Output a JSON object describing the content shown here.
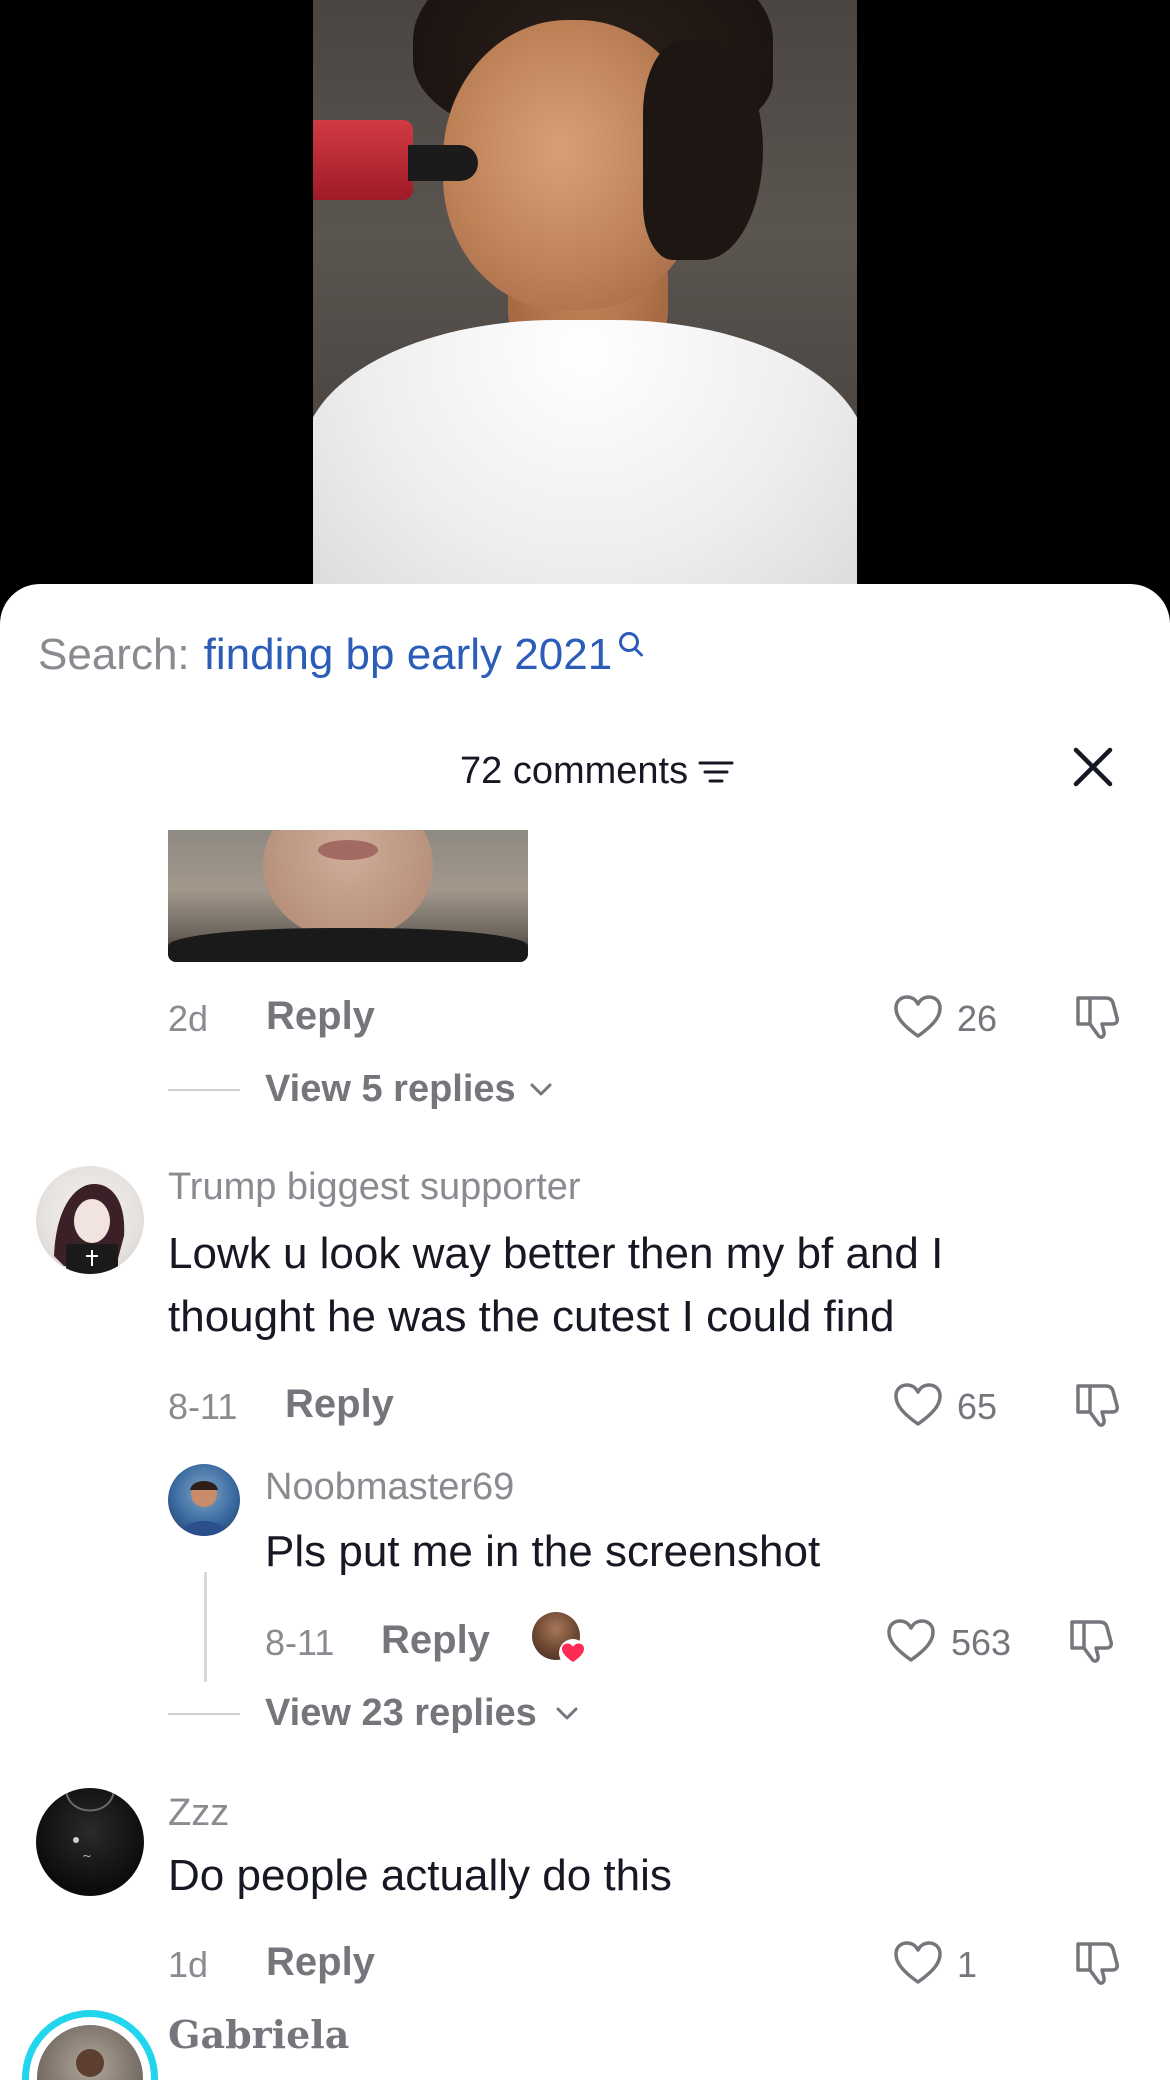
{
  "search": {
    "label": "Search:",
    "query": "finding bp early 2021"
  },
  "header": {
    "comment_count": "72 comments"
  },
  "comments": [
    {
      "time": "2d",
      "reply_label": "Reply",
      "likes": "26",
      "view_replies": "View 5 replies"
    },
    {
      "username": "Trump biggest supporter",
      "text_line1": "Lowk u look way better then my bf and I",
      "text_line2": "thought he was the cutest I could find",
      "time": "8-11",
      "reply_label": "Reply",
      "likes": "65",
      "reply": {
        "username": "Noobmaster69",
        "text": "Pls put me in the screenshot",
        "time": "8-11",
        "reply_label": "Reply",
        "likes": "563"
      },
      "view_replies": "View 23 replies"
    },
    {
      "username": "Zzz",
      "text": "Do people actually do this",
      "time": "1d",
      "reply_label": "Reply",
      "likes": "1"
    },
    {
      "username": "Gabriela"
    }
  ],
  "colors": {
    "accent_link": "#2b5db8",
    "muted": "#8a8b91",
    "heart_red": "#fe2c55",
    "story_ring": "#20d5ec"
  }
}
